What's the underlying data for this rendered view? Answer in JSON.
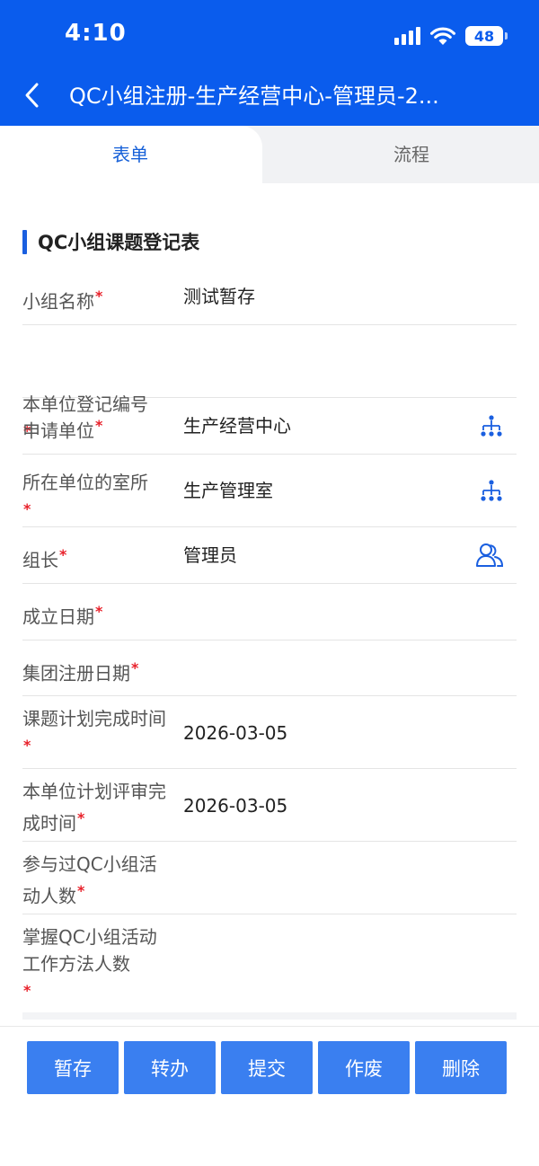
{
  "status": {
    "time": "4:10",
    "battery": "48",
    "icons": [
      "signal-icon",
      "wifi-icon",
      "battery-icon"
    ]
  },
  "header": {
    "title": "QC小组注册-生产经营中心-管理员-2...",
    "back_icon": "chevron-left-icon"
  },
  "tabs": [
    {
      "label": "表单",
      "active": true
    },
    {
      "label": "流程",
      "active": false
    }
  ],
  "section": {
    "title": "QC小组课题登记表"
  },
  "form": {
    "rows": [
      {
        "label": "小组名称",
        "required": "*",
        "value": "测试暂存"
      },
      {
        "label": "本单位登记编号",
        "required": "*",
        "value": ""
      },
      {
        "label": "申请单位",
        "required": "*",
        "value": "生产经营中心",
        "icon": "org-tree-icon"
      },
      {
        "label": "所在单位的室所",
        "required": "*",
        "value": "生产管理室",
        "icon": "org-tree-icon"
      },
      {
        "label": "组长",
        "required": "*",
        "value": "管理员",
        "icon": "users-icon"
      },
      {
        "label": "成立日期",
        "required": "*",
        "value": ""
      },
      {
        "label": "集团注册日期",
        "required": "*",
        "value": ""
      },
      {
        "label": "课题计划完成时间",
        "required": "*",
        "value": "2026-03-05"
      },
      {
        "label": "本单位计划评审完成时间",
        "required": "*",
        "value": "2026-03-05"
      },
      {
        "label": "参与过QC小组活动人数",
        "required": "*",
        "value": ""
      },
      {
        "label": "掌握QC小组活动工作方法人数",
        "required": "*",
        "value": ""
      }
    ]
  },
  "actions": {
    "save_draft": "暂存",
    "transfer": "转办",
    "submit": "提交",
    "void": "作废",
    "delete": "删除"
  },
  "colors": {
    "brand": "#0a5ced",
    "button": "#3a7ff0",
    "required": "#e8202a",
    "tab_active_text": "#1660d8"
  }
}
